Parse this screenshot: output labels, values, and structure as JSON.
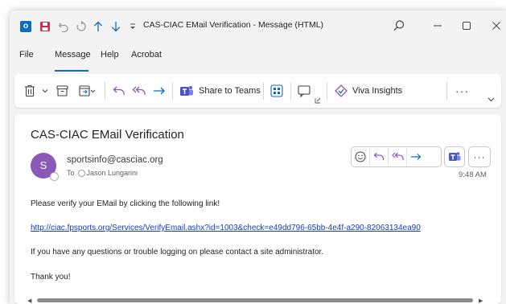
{
  "titlebar": {
    "logo_letter": "o",
    "title": "CAS-CIAC EMail Verification  -  Message (HTML)"
  },
  "menu": {
    "items": [
      "File",
      "Message",
      "Help",
      "Acrobat"
    ],
    "active": "Message"
  },
  "ribbon": {
    "share_to_teams": "Share to Teams",
    "viva_insights": "Viva Insights",
    "more": "···"
  },
  "message": {
    "subject": "CAS-CIAC EMail Verification",
    "avatar_letter": "S",
    "sender": "sportsinfo@casciac.org",
    "to_label": "To",
    "to_name": "Jason Lungarini",
    "time": "9:48 AM",
    "body_line1": "Please verify your EMail by clicking the following link!",
    "link": "http://ciac.fpsports.org/Services/VerifyEmail.ashx?id=1003&check=e49dd796-65bb-4e4f-a290-82063134ea90",
    "body_line2": "If you have any questions or trouble logging on please contact a site administrator.",
    "body_line3": "Thank you!",
    "more": "···"
  },
  "colors": {
    "accent": "#0f6cbd",
    "avatar": "#8a58b6",
    "reply_purple": "#8a58b6",
    "link": "#0f3cc9"
  }
}
